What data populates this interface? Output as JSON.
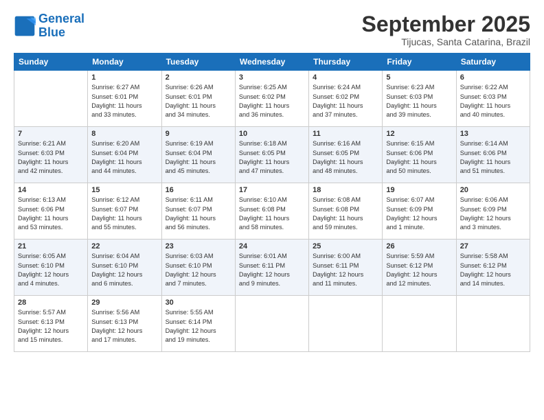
{
  "logo": {
    "line1": "General",
    "line2": "Blue"
  },
  "title": "September 2025",
  "location": "Tijucas, Santa Catarina, Brazil",
  "days_of_week": [
    "Sunday",
    "Monday",
    "Tuesday",
    "Wednesday",
    "Thursday",
    "Friday",
    "Saturday"
  ],
  "weeks": [
    [
      {
        "num": "",
        "info": ""
      },
      {
        "num": "1",
        "info": "Sunrise: 6:27 AM\nSunset: 6:01 PM\nDaylight: 11 hours\nand 33 minutes."
      },
      {
        "num": "2",
        "info": "Sunrise: 6:26 AM\nSunset: 6:01 PM\nDaylight: 11 hours\nand 34 minutes."
      },
      {
        "num": "3",
        "info": "Sunrise: 6:25 AM\nSunset: 6:02 PM\nDaylight: 11 hours\nand 36 minutes."
      },
      {
        "num": "4",
        "info": "Sunrise: 6:24 AM\nSunset: 6:02 PM\nDaylight: 11 hours\nand 37 minutes."
      },
      {
        "num": "5",
        "info": "Sunrise: 6:23 AM\nSunset: 6:03 PM\nDaylight: 11 hours\nand 39 minutes."
      },
      {
        "num": "6",
        "info": "Sunrise: 6:22 AM\nSunset: 6:03 PM\nDaylight: 11 hours\nand 40 minutes."
      }
    ],
    [
      {
        "num": "7",
        "info": "Sunrise: 6:21 AM\nSunset: 6:03 PM\nDaylight: 11 hours\nand 42 minutes."
      },
      {
        "num": "8",
        "info": "Sunrise: 6:20 AM\nSunset: 6:04 PM\nDaylight: 11 hours\nand 44 minutes."
      },
      {
        "num": "9",
        "info": "Sunrise: 6:19 AM\nSunset: 6:04 PM\nDaylight: 11 hours\nand 45 minutes."
      },
      {
        "num": "10",
        "info": "Sunrise: 6:18 AM\nSunset: 6:05 PM\nDaylight: 11 hours\nand 47 minutes."
      },
      {
        "num": "11",
        "info": "Sunrise: 6:16 AM\nSunset: 6:05 PM\nDaylight: 11 hours\nand 48 minutes."
      },
      {
        "num": "12",
        "info": "Sunrise: 6:15 AM\nSunset: 6:06 PM\nDaylight: 11 hours\nand 50 minutes."
      },
      {
        "num": "13",
        "info": "Sunrise: 6:14 AM\nSunset: 6:06 PM\nDaylight: 11 hours\nand 51 minutes."
      }
    ],
    [
      {
        "num": "14",
        "info": "Sunrise: 6:13 AM\nSunset: 6:06 PM\nDaylight: 11 hours\nand 53 minutes."
      },
      {
        "num": "15",
        "info": "Sunrise: 6:12 AM\nSunset: 6:07 PM\nDaylight: 11 hours\nand 55 minutes."
      },
      {
        "num": "16",
        "info": "Sunrise: 6:11 AM\nSunset: 6:07 PM\nDaylight: 11 hours\nand 56 minutes."
      },
      {
        "num": "17",
        "info": "Sunrise: 6:10 AM\nSunset: 6:08 PM\nDaylight: 11 hours\nand 58 minutes."
      },
      {
        "num": "18",
        "info": "Sunrise: 6:08 AM\nSunset: 6:08 PM\nDaylight: 11 hours\nand 59 minutes."
      },
      {
        "num": "19",
        "info": "Sunrise: 6:07 AM\nSunset: 6:09 PM\nDaylight: 12 hours\nand 1 minute."
      },
      {
        "num": "20",
        "info": "Sunrise: 6:06 AM\nSunset: 6:09 PM\nDaylight: 12 hours\nand 3 minutes."
      }
    ],
    [
      {
        "num": "21",
        "info": "Sunrise: 6:05 AM\nSunset: 6:10 PM\nDaylight: 12 hours\nand 4 minutes."
      },
      {
        "num": "22",
        "info": "Sunrise: 6:04 AM\nSunset: 6:10 PM\nDaylight: 12 hours\nand 6 minutes."
      },
      {
        "num": "23",
        "info": "Sunrise: 6:03 AM\nSunset: 6:10 PM\nDaylight: 12 hours\nand 7 minutes."
      },
      {
        "num": "24",
        "info": "Sunrise: 6:01 AM\nSunset: 6:11 PM\nDaylight: 12 hours\nand 9 minutes."
      },
      {
        "num": "25",
        "info": "Sunrise: 6:00 AM\nSunset: 6:11 PM\nDaylight: 12 hours\nand 11 minutes."
      },
      {
        "num": "26",
        "info": "Sunrise: 5:59 AM\nSunset: 6:12 PM\nDaylight: 12 hours\nand 12 minutes."
      },
      {
        "num": "27",
        "info": "Sunrise: 5:58 AM\nSunset: 6:12 PM\nDaylight: 12 hours\nand 14 minutes."
      }
    ],
    [
      {
        "num": "28",
        "info": "Sunrise: 5:57 AM\nSunset: 6:13 PM\nDaylight: 12 hours\nand 15 minutes."
      },
      {
        "num": "29",
        "info": "Sunrise: 5:56 AM\nSunset: 6:13 PM\nDaylight: 12 hours\nand 17 minutes."
      },
      {
        "num": "30",
        "info": "Sunrise: 5:55 AM\nSunset: 6:14 PM\nDaylight: 12 hours\nand 19 minutes."
      },
      {
        "num": "",
        "info": ""
      },
      {
        "num": "",
        "info": ""
      },
      {
        "num": "",
        "info": ""
      },
      {
        "num": "",
        "info": ""
      }
    ]
  ]
}
